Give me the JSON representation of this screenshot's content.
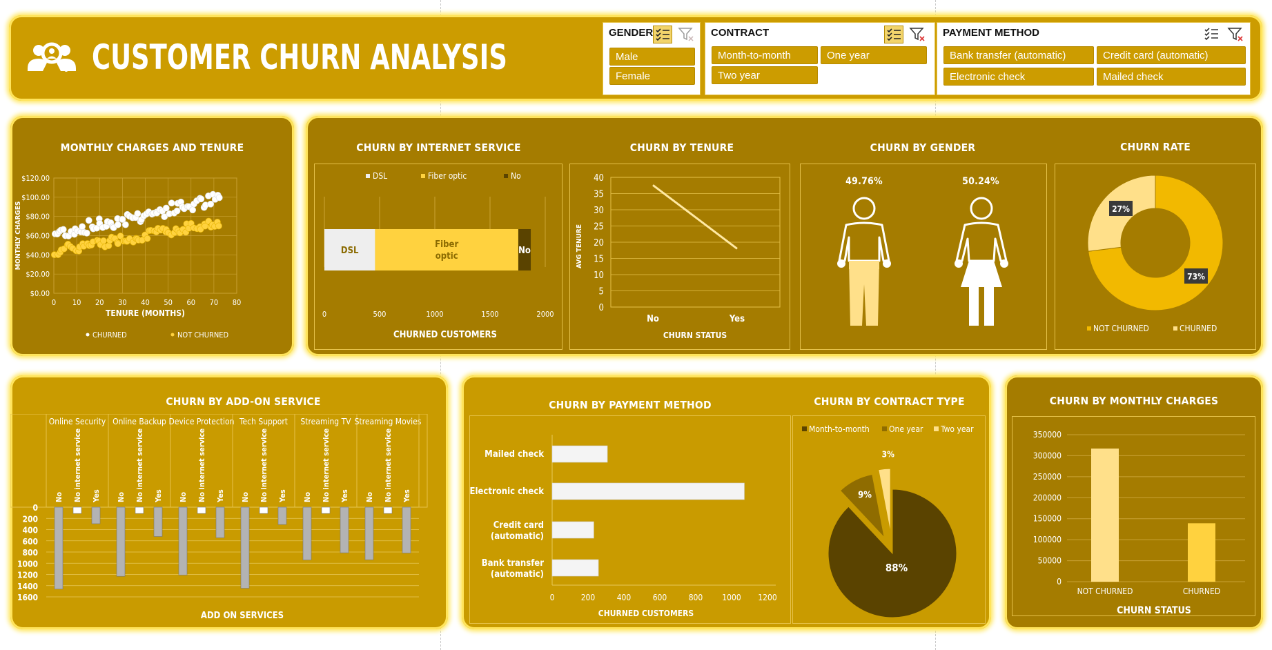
{
  "header": {
    "title": "CUSTOMER CHURN ANALYSIS",
    "logo_icon": "customer-search-icon"
  },
  "slicers": {
    "gender": {
      "title": "GENDER",
      "items": [
        "Male",
        "Female"
      ]
    },
    "contract": {
      "title": "CONTRACT",
      "items": [
        "Month-to-month",
        "One year",
        "Two year"
      ]
    },
    "payment": {
      "title": "PAYMENT METHOD",
      "items": [
        "Bank transfer (automatic)",
        "Credit card (automatic)",
        "Electronic check",
        "Mailed check"
      ]
    }
  },
  "colors": {
    "header_bg": "#cc9c00",
    "panel_dark": "#a57c00",
    "panel_light": "#c99b00",
    "glow": "#ffe45c",
    "cream": "#ffe08a",
    "accent": "#ffd23f"
  },
  "charts": {
    "monthly_tenure": {
      "title": "MONTHLY CHARGES AND TENURE",
      "ylabel": "MONTHLY CHARGES",
      "xlabel": "TENURE (MONTHS)",
      "yticks": [
        "$120.00",
        "$100.00",
        "$80.00",
        "$60.00",
        "$40.00",
        "$20.00",
        "$0.00"
      ],
      "xticks": [
        "0",
        "10",
        "20",
        "30",
        "40",
        "50",
        "60",
        "70",
        "80"
      ],
      "legend": [
        "CHURNED",
        "NOT CHURNED"
      ]
    },
    "internet": {
      "title": "CHURN BY INTERNET SERVICE",
      "legend": [
        "DSL",
        "Fiber optic",
        "No"
      ],
      "seg_labels": [
        "DSL",
        "Fiber optic",
        "No"
      ],
      "values": [
        459,
        1297,
        113
      ],
      "xticks": [
        "0",
        "500",
        "1000",
        "1500",
        "2000"
      ],
      "xlabel": "CHURNED CUSTOMERS"
    },
    "tenure": {
      "title": "CHURN BY TENURE",
      "ylabel": "AVG TENURE",
      "xlabel": "CHURN STATUS",
      "categories": [
        "No",
        "Yes"
      ],
      "values": [
        37.6,
        18
      ],
      "yticks": [
        "40",
        "35",
        "30",
        "25",
        "20",
        "15",
        "10",
        "5",
        "0"
      ]
    },
    "gender": {
      "title": "CHURN BY GENDER",
      "male_pct": "49.76%",
      "female_pct": "50.24%"
    },
    "rate": {
      "title": "CHURN RATE",
      "labels": [
        "73%",
        "27%"
      ],
      "values": [
        73,
        27
      ],
      "legend": [
        "NOT CHURNED",
        "CHURNED"
      ]
    },
    "addon": {
      "title": "CHURN BY ADD-ON SERVICE",
      "groups": [
        "Online Security",
        "Online Backup",
        "Device Protection",
        "Tech Support",
        "Streaming TV",
        "Streaming Movies"
      ],
      "subcats": [
        "No",
        "No internet service",
        "Yes"
      ],
      "values": [
        [
          1461,
          113,
          295
        ],
        [
          1233,
          113,
          523
        ],
        [
          1211,
          113,
          545
        ],
        [
          1446,
          113,
          310
        ],
        [
          942,
          113,
          814
        ],
        [
          938,
          113,
          818
        ]
      ],
      "yticks": [
        "0",
        "200",
        "400",
        "600",
        "800",
        "1000",
        "1200",
        "1400",
        "1600"
      ],
      "xlabel": "ADD ON SERVICES"
    },
    "payment": {
      "title": "CHURN BY PAYMENT METHOD",
      "categories": [
        "Mailed check",
        "Electronic check",
        "Credit card (automatic)",
        "Bank transfer (automatic)"
      ],
      "values": [
        308,
        1071,
        232,
        258
      ],
      "xticks": [
        "0",
        "200",
        "400",
        "600",
        "800",
        "1000",
        "1200"
      ],
      "xlabel": "CHURNED CUSTOMERS"
    },
    "contract": {
      "title": "CHURN BY CONTRACT TYPE",
      "legend": [
        "Month-to-month",
        "One year",
        "Two year"
      ],
      "values": [
        88,
        9,
        3
      ],
      "labels": [
        "88%",
        "9%",
        "3%"
      ]
    },
    "monthly_charges": {
      "title": "CHURN BY MONTHLY CHARGES",
      "categories": [
        "NOT CHURNED",
        "CHURNED"
      ],
      "values": [
        316986,
        139131
      ],
      "yticks": [
        "350000",
        "300000",
        "250000",
        "200000",
        "150000",
        "100000",
        "50000",
        "0"
      ],
      "xlabel": "CHURN STATUS"
    }
  }
}
